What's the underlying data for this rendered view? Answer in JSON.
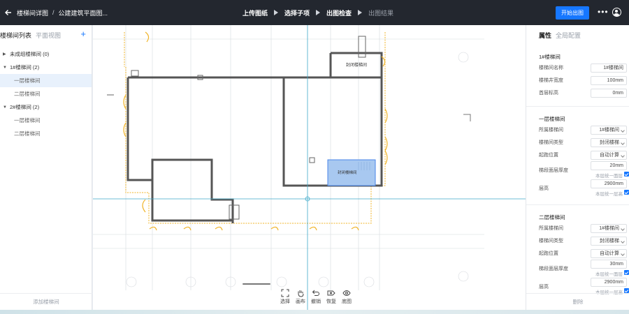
{
  "topbar": {
    "back_icon": "arrow-left-icon",
    "breadcrumb_1": "楼梯间详图",
    "breadcrumb_sep": "/",
    "breadcrumb_2": "公建建筑平面图...",
    "steps": [
      {
        "label": "上传图纸",
        "active": true
      },
      {
        "label": "选择子项",
        "active": true
      },
      {
        "label": "出图检查",
        "active": true
      },
      {
        "label": "出图结果",
        "active": false
      }
    ],
    "start_button": "开始出图",
    "more_icon": "more-dots-icon",
    "user_icon": "user-avatar-icon",
    "accent_color": "#1677ff"
  },
  "sidebar": {
    "tab_active": "楼梯间列表",
    "tab_inactive": "平面视图",
    "add_icon": "+",
    "tree": [
      {
        "label": "未成组楼梯间 (0)",
        "type": "group",
        "expanded": false
      },
      {
        "label": "1#楼梯间 (2)",
        "type": "group",
        "expanded": true
      },
      {
        "label": "一层楼梯间",
        "type": "child",
        "selected": true
      },
      {
        "label": "二层楼梯间",
        "type": "child",
        "selected": false
      },
      {
        "label": "2#楼梯间 (2)",
        "type": "group",
        "expanded": true
      },
      {
        "label": "一层楼梯间",
        "type": "child",
        "selected": false
      },
      {
        "label": "二层楼梯间",
        "type": "child",
        "selected": false
      }
    ],
    "bottom_button": "添加楼梯间"
  },
  "canvas": {
    "room_label_top": "封闭楼梯间",
    "room_label_selected": "封闭楼梯间",
    "selected_fill": "#a8c8f0",
    "tools": [
      {
        "label": "选择",
        "icon": "select-frame-icon"
      },
      {
        "label": "画布",
        "icon": "hand-pan-icon"
      },
      {
        "label": "撤销",
        "icon": "undo-icon"
      },
      {
        "label": "恢复",
        "icon": "redo-clear-icon"
      },
      {
        "label": "底图",
        "icon": "eye-icon"
      }
    ]
  },
  "properties": {
    "tab_active": "属性",
    "tab_inactive": "全局配置",
    "section_1": {
      "title": "1#楼梯间",
      "name_label": "楼梯间名称",
      "name_value": "1#楼梯间",
      "width_label": "楼梯井宽度",
      "width_value": "100mm",
      "elev_label": "首层标高",
      "elev_value": "0mm"
    },
    "section_2": {
      "title": "一层楼梯间",
      "belong_label": "所属楼梯间",
      "belong_value": "1#楼梯间",
      "type_label": "楼梯间类型",
      "type_value": "封闭楼梯",
      "start_label": "起跑位置",
      "start_value": "自动计算",
      "thick_label": "梯段面层厚度",
      "thick_value": "20mm",
      "thick_sub": "本层统一面层",
      "height_label": "层高",
      "height_value": "2900mm",
      "height_sub": "本层统一层高"
    },
    "section_3": {
      "title": "二层楼梯间",
      "belong_label": "所属楼梯间",
      "belong_value": "1#楼梯间",
      "type_label": "楼梯间类型",
      "type_value": "封闭楼梯",
      "start_label": "起跑位置",
      "start_value": "自动计算",
      "thick_label": "梯段面层厚度",
      "thick_value": "30mm",
      "thick_sub": "本层统一面层",
      "height_label": "层高",
      "height_value": "2900mm",
      "height_sub": "本层统一层高"
    },
    "bottom_button": "删除"
  }
}
